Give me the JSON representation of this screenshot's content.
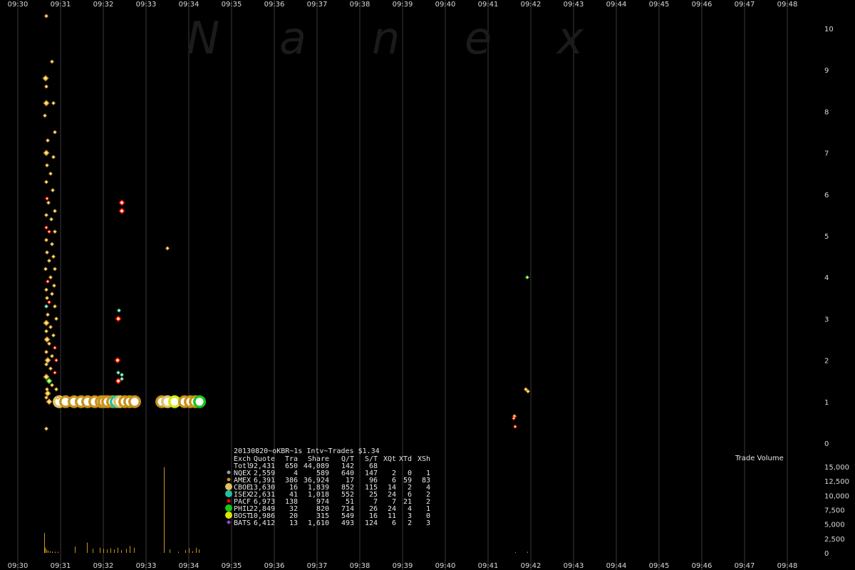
{
  "chart_data": {
    "type": "scatter",
    "title": "20130820~oKBR~1s Intv~Trades $1.34",
    "watermark": [
      "N",
      "a",
      "n",
      "e",
      "x"
    ],
    "x_ticks": [
      "09:30",
      "09:31",
      "09:32",
      "09:33",
      "09:34",
      "09:35",
      "09:36",
      "09:37",
      "09:38",
      "09:39",
      "09:40",
      "09:41",
      "09:42",
      "09:43",
      "09:44",
      "09:45",
      "09:46",
      "09:47",
      "09:48"
    ],
    "price_axis": {
      "ylim": [
        0,
        10
      ],
      "ticks": [
        "0",
        "1",
        "2",
        "3",
        "4",
        "5",
        "6",
        "7",
        "8",
        "9",
        "10"
      ]
    },
    "volume_axis": {
      "label": "Trade Volume",
      "ylim": [
        0,
        15000
      ],
      "ticks": [
        "0",
        "2,500",
        "5,000",
        "7,500",
        "10,000",
        "12,500",
        "15,000"
      ]
    },
    "colors": {
      "background": "#000000",
      "gridline": "#3a3a3a",
      "NQEX": "#9a9a9a",
      "AMEX": "#c8921a",
      "CBOE": "#e0c060",
      "ISEX": "#20c0a0",
      "PACF": "#ff0000",
      "PHIL": "#18c818",
      "BOST": "#d8e800",
      "BATS": "#a040e0",
      "trade": "#ffe0a0",
      "volume_bar": "#c8921a"
    },
    "table": {
      "header": [
        "Exch",
        "Quote",
        "Tra",
        "Share",
        "Q/T",
        "S/T",
        "XQt",
        "XTd",
        "XSh"
      ],
      "total": [
        "Totl",
        "92,431",
        "650",
        "44,089",
        "142",
        "68",
        "",
        "",
        ""
      ],
      "rows": [
        {
          "exch": "NQEX",
          "quote": "2,559",
          "tra": "4",
          "share": "589",
          "qt": "640",
          "st": "147",
          "xqt": "2",
          "xtd": "0",
          "xsh": "1",
          "color": "#9a9a9a",
          "marker": "circle-small"
        },
        {
          "exch": "AMEX",
          "quote": "6,391",
          "tra": "386",
          "share": "36,924",
          "qt": "17",
          "st": "96",
          "xqt": "6",
          "xtd": "59",
          "xsh": "83",
          "color": "#c8921a",
          "marker": "circle-small"
        },
        {
          "exch": "CBOE",
          "quote": "13,630",
          "tra": "16",
          "share": "1,839",
          "qt": "852",
          "st": "115",
          "xqt": "14",
          "xtd": "2",
          "xsh": "4",
          "color": "#e0c060",
          "marker": "circle-large"
        },
        {
          "exch": "ISEX",
          "quote": "22,631",
          "tra": "41",
          "share": "1,018",
          "qt": "552",
          "st": "25",
          "xqt": "24",
          "xtd": "6",
          "xsh": "2",
          "color": "#20c0a0",
          "marker": "circle-large"
        },
        {
          "exch": "PACF",
          "quote": "6,973",
          "tra": "138",
          "share": "974",
          "qt": "51",
          "st": "7",
          "xqt": "7",
          "xtd": "21",
          "xsh": "2",
          "color": "#ff0000",
          "marker": "circle-small"
        },
        {
          "exch": "PHIL",
          "quote": "22,849",
          "tra": "32",
          "share": "820",
          "qt": "714",
          "st": "26",
          "xqt": "24",
          "xtd": "4",
          "xsh": "1",
          "color": "#18c818",
          "marker": "circle-large"
        },
        {
          "exch": "BOST",
          "quote": "10,986",
          "tra": "20",
          "share": "315",
          "qt": "549",
          "st": "16",
          "xqt": "11",
          "xtd": "3",
          "xsh": "0",
          "color": "#d8e800",
          "marker": "circle-large"
        },
        {
          "exch": "BATS",
          "quote": "6,412",
          "tra": "13",
          "share": "1,610",
          "qt": "493",
          "st": "124",
          "xqt": "6",
          "xtd": "2",
          "xsh": "3",
          "color": "#a040e0",
          "marker": "diamond"
        }
      ]
    },
    "trades": [
      {
        "t": "09:30:40",
        "p": 10.3,
        "ex": "AMEX",
        "s": "s"
      },
      {
        "t": "09:30:48",
        "p": 9.2,
        "ex": "AMEX",
        "s": "s"
      },
      {
        "t": "09:30:39",
        "p": 8.8,
        "ex": "AMEX",
        "s": "m"
      },
      {
        "t": "09:30:40",
        "p": 8.6,
        "ex": "AMEX",
        "s": "s"
      },
      {
        "t": "09:30:40",
        "p": 8.2,
        "ex": "AMEX",
        "s": "m"
      },
      {
        "t": "09:30:50",
        "p": 8.2,
        "ex": "AMEX",
        "s": "s"
      },
      {
        "t": "09:30:38",
        "p": 7.9,
        "ex": "AMEX",
        "s": "s"
      },
      {
        "t": "09:30:52",
        "p": 7.5,
        "ex": "AMEX",
        "s": "s"
      },
      {
        "t": "09:30:42",
        "p": 7.3,
        "ex": "AMEX",
        "s": "s"
      },
      {
        "t": "09:30:40",
        "p": 7.0,
        "ex": "AMEX",
        "s": "m"
      },
      {
        "t": "09:30:50",
        "p": 6.9,
        "ex": "AMEX",
        "s": "s"
      },
      {
        "t": "09:30:41",
        "p": 6.7,
        "ex": "AMEX",
        "s": "s"
      },
      {
        "t": "09:30:46",
        "p": 6.5,
        "ex": "AMEX",
        "s": "s"
      },
      {
        "t": "09:30:40",
        "p": 6.3,
        "ex": "AMEX",
        "s": "s"
      },
      {
        "t": "09:30:49",
        "p": 6.1,
        "ex": "AMEX",
        "s": "s"
      },
      {
        "t": "09:30:41",
        "p": 5.9,
        "ex": "PACF",
        "s": "s"
      },
      {
        "t": "09:30:43",
        "p": 5.8,
        "ex": "AMEX",
        "s": "s"
      },
      {
        "t": "09:30:52",
        "p": 5.6,
        "ex": "AMEX",
        "s": "s"
      },
      {
        "t": "09:30:40",
        "p": 5.5,
        "ex": "AMEX",
        "s": "s"
      },
      {
        "t": "09:30:47",
        "p": 5.4,
        "ex": "AMEX",
        "s": "s"
      },
      {
        "t": "09:30:40",
        "p": 5.2,
        "ex": "PACF",
        "s": "s"
      },
      {
        "t": "09:30:44",
        "p": 5.1,
        "ex": "PACF",
        "s": "s"
      },
      {
        "t": "09:30:52",
        "p": 5.1,
        "ex": "AMEX",
        "s": "s"
      },
      {
        "t": "09:30:40",
        "p": 4.9,
        "ex": "AMEX",
        "s": "s"
      },
      {
        "t": "09:30:48",
        "p": 4.8,
        "ex": "AMEX",
        "s": "s"
      },
      {
        "t": "09:30:41",
        "p": 4.6,
        "ex": "AMEX",
        "s": "s"
      },
      {
        "t": "09:30:50",
        "p": 4.5,
        "ex": "AMEX",
        "s": "s"
      },
      {
        "t": "09:30:44",
        "p": 4.4,
        "ex": "AMEX",
        "s": "s"
      },
      {
        "t": "09:30:39",
        "p": 4.2,
        "ex": "AMEX",
        "s": "s"
      },
      {
        "t": "09:30:52",
        "p": 4.2,
        "ex": "AMEX",
        "s": "s"
      },
      {
        "t": "09:30:46",
        "p": 4.0,
        "ex": "AMEX",
        "s": "s"
      },
      {
        "t": "09:30:42",
        "p": 3.9,
        "ex": "PACF",
        "s": "s"
      },
      {
        "t": "09:30:51",
        "p": 3.8,
        "ex": "AMEX",
        "s": "s"
      },
      {
        "t": "09:30:40",
        "p": 3.7,
        "ex": "AMEX",
        "s": "s"
      },
      {
        "t": "09:30:48",
        "p": 3.6,
        "ex": "AMEX",
        "s": "s"
      },
      {
        "t": "09:30:41",
        "p": 3.5,
        "ex": "AMEX",
        "s": "s"
      },
      {
        "t": "09:30:44",
        "p": 3.4,
        "ex": "PACF",
        "s": "s"
      },
      {
        "t": "09:30:40",
        "p": 3.3,
        "ex": "ISEX",
        "s": "s"
      },
      {
        "t": "09:30:52",
        "p": 3.3,
        "ex": "AMEX",
        "s": "s"
      },
      {
        "t": "09:30:42",
        "p": 3.1,
        "ex": "AMEX",
        "s": "s"
      },
      {
        "t": "09:30:54",
        "p": 3.0,
        "ex": "AMEX",
        "s": "s"
      },
      {
        "t": "09:30:40",
        "p": 2.9,
        "ex": "AMEX",
        "s": "m"
      },
      {
        "t": "09:30:46",
        "p": 2.8,
        "ex": "AMEX",
        "s": "s"
      },
      {
        "t": "09:30:40",
        "p": 2.7,
        "ex": "AMEX",
        "s": "s"
      },
      {
        "t": "09:30:50",
        "p": 2.6,
        "ex": "AMEX",
        "s": "s"
      },
      {
        "t": "09:30:41",
        "p": 2.5,
        "ex": "AMEX",
        "s": "m"
      },
      {
        "t": "09:30:44",
        "p": 2.4,
        "ex": "AMEX",
        "s": "s"
      },
      {
        "t": "09:30:52",
        "p": 2.3,
        "ex": "PACF",
        "s": "s"
      },
      {
        "t": "09:30:40",
        "p": 2.2,
        "ex": "AMEX",
        "s": "s"
      },
      {
        "t": "09:30:48",
        "p": 2.1,
        "ex": "AMEX",
        "s": "s"
      },
      {
        "t": "09:30:42",
        "p": 2.0,
        "ex": "AMEX",
        "s": "m"
      },
      {
        "t": "09:30:54",
        "p": 2.0,
        "ex": "PACF",
        "s": "s"
      },
      {
        "t": "09:30:40",
        "p": 1.9,
        "ex": "AMEX",
        "s": "s"
      },
      {
        "t": "09:30:46",
        "p": 1.8,
        "ex": "AMEX",
        "s": "s"
      },
      {
        "t": "09:30:52",
        "p": 1.7,
        "ex": "PACF",
        "s": "s"
      },
      {
        "t": "09:30:40",
        "p": 1.6,
        "ex": "AMEX",
        "s": "m"
      },
      {
        "t": "09:30:44",
        "p": 1.5,
        "ex": "PHIL",
        "s": "m"
      },
      {
        "t": "09:30:48",
        "p": 1.4,
        "ex": "AMEX",
        "s": "s"
      },
      {
        "t": "09:30:41",
        "p": 1.3,
        "ex": "AMEX",
        "s": "s"
      },
      {
        "t": "09:30:54",
        "p": 1.3,
        "ex": "AMEX",
        "s": "s"
      },
      {
        "t": "09:30:42",
        "p": 1.2,
        "ex": "AMEX",
        "s": "m"
      },
      {
        "t": "09:30:40",
        "p": 1.1,
        "ex": "AMEX",
        "s": "s"
      },
      {
        "t": "09:30:56",
        "p": 1.1,
        "ex": "AMEX",
        "s": "s"
      },
      {
        "t": "09:30:44",
        "p": 1.0,
        "ex": "AMEX",
        "s": "m"
      },
      {
        "t": "09:30:40",
        "p": 0.35,
        "ex": "AMEX",
        "s": "s"
      },
      {
        "t": "09:32:26",
        "p": 5.8,
        "ex": "PACF",
        "s": "m"
      },
      {
        "t": "09:32:26",
        "p": 5.6,
        "ex": "PACF",
        "s": "m"
      },
      {
        "t": "09:32:22",
        "p": 3.2,
        "ex": "ISEX",
        "s": "s"
      },
      {
        "t": "09:32:21",
        "p": 3.0,
        "ex": "PACF",
        "s": "m"
      },
      {
        "t": "09:32:20",
        "p": 2.0,
        "ex": "PACF",
        "s": "m"
      },
      {
        "t": "09:32:21",
        "p": 1.7,
        "ex": "ISEX",
        "s": "s"
      },
      {
        "t": "09:32:26",
        "p": 1.65,
        "ex": "ISEX",
        "s": "s"
      },
      {
        "t": "09:32:26",
        "p": 1.55,
        "ex": "ISEX",
        "s": "s"
      },
      {
        "t": "09:32:21",
        "p": 1.5,
        "ex": "PACF",
        "s": "m"
      },
      {
        "t": "09:33:30",
        "p": 4.7,
        "ex": "AMEX",
        "s": "s"
      },
      {
        "t": "09:41:55",
        "p": 4.0,
        "ex": "PHIL",
        "s": "s"
      },
      {
        "t": "09:41:53",
        "p": 1.3,
        "ex": "AMEX",
        "s": "s"
      },
      {
        "t": "09:41:56",
        "p": 1.25,
        "ex": "AMEX",
        "s": "s"
      },
      {
        "t": "09:41:37",
        "p": 0.65,
        "ex": "AMEX",
        "s": "s"
      },
      {
        "t": "09:41:36",
        "p": 0.6,
        "ex": "PACF",
        "s": "s"
      },
      {
        "t": "09:41:38",
        "p": 0.4,
        "ex": "PACF",
        "s": "s"
      }
    ],
    "large_trades": [
      {
        "t": "09:30:58",
        "p": 1.0,
        "ex": "CBOE"
      },
      {
        "t": "09:31:07",
        "p": 1.0,
        "ex": "AMEX"
      },
      {
        "t": "09:31:19",
        "p": 1.0,
        "ex": "AMEX"
      },
      {
        "t": "09:31:29",
        "p": 1.0,
        "ex": "AMEX"
      },
      {
        "t": "09:31:38",
        "p": 1.0,
        "ex": "AMEX"
      },
      {
        "t": "09:31:48",
        "p": 1.0,
        "ex": "AMEX"
      },
      {
        "t": "09:31:57",
        "p": 1.0,
        "ex": "AMEX"
      },
      {
        "t": "09:32:01",
        "p": 1.0,
        "ex": "AMEX"
      },
      {
        "t": "09:32:06",
        "p": 1.0,
        "ex": "AMEX"
      },
      {
        "t": "09:32:13",
        "p": 1.0,
        "ex": "AMEX"
      },
      {
        "t": "09:32:18",
        "p": 1.0,
        "ex": "ISEX"
      },
      {
        "t": "09:32:23",
        "p": 1.0,
        "ex": "CBOE"
      },
      {
        "t": "09:32:30",
        "p": 1.0,
        "ex": "AMEX"
      },
      {
        "t": "09:32:37",
        "p": 1.0,
        "ex": "AMEX"
      },
      {
        "t": "09:32:44",
        "p": 1.0,
        "ex": "AMEX"
      },
      {
        "t": "09:33:22",
        "p": 1.0,
        "ex": "AMEX"
      },
      {
        "t": "09:33:30",
        "p": 1.0,
        "ex": "CBOE"
      },
      {
        "t": "09:33:40",
        "p": 1.0,
        "ex": "BOST"
      },
      {
        "t": "09:33:54",
        "p": 1.0,
        "ex": "AMEX"
      },
      {
        "t": "09:34:02",
        "p": 1.0,
        "ex": "AMEX"
      },
      {
        "t": "09:34:09",
        "p": 1.0,
        "ex": "AMEX"
      },
      {
        "t": "09:34:15",
        "p": 1.0,
        "ex": "PHIL"
      }
    ],
    "volume": [
      {
        "t": "09:30:37",
        "v": 3500
      },
      {
        "t": "09:30:38",
        "v": 900
      },
      {
        "t": "09:30:40",
        "v": 600
      },
      {
        "t": "09:30:42",
        "v": 400
      },
      {
        "t": "09:30:45",
        "v": 300
      },
      {
        "t": "09:30:48",
        "v": 250
      },
      {
        "t": "09:30:52",
        "v": 200
      },
      {
        "t": "09:30:56",
        "v": 200
      },
      {
        "t": "09:31:20",
        "v": 1100
      },
      {
        "t": "09:31:37",
        "v": 1800
      },
      {
        "t": "09:31:45",
        "v": 700
      },
      {
        "t": "09:31:55",
        "v": 900
      },
      {
        "t": "09:32:00",
        "v": 700
      },
      {
        "t": "09:32:05",
        "v": 600
      },
      {
        "t": "09:32:10",
        "v": 800
      },
      {
        "t": "09:32:15",
        "v": 600
      },
      {
        "t": "09:32:20",
        "v": 900
      },
      {
        "t": "09:32:25",
        "v": 500
      },
      {
        "t": "09:32:32",
        "v": 700
      },
      {
        "t": "09:32:37",
        "v": 1200
      },
      {
        "t": "09:32:43",
        "v": 900
      },
      {
        "t": "09:33:25",
        "v": 14900
      },
      {
        "t": "09:33:33",
        "v": 600
      },
      {
        "t": "09:33:45",
        "v": 200
      },
      {
        "t": "09:33:55",
        "v": 500
      },
      {
        "t": "09:34:00",
        "v": 800
      },
      {
        "t": "09:34:05",
        "v": 300
      },
      {
        "t": "09:34:10",
        "v": 900
      },
      {
        "t": "09:34:14",
        "v": 600
      },
      {
        "t": "09:41:38",
        "v": 150
      },
      {
        "t": "09:41:55",
        "v": 200
      }
    ]
  }
}
